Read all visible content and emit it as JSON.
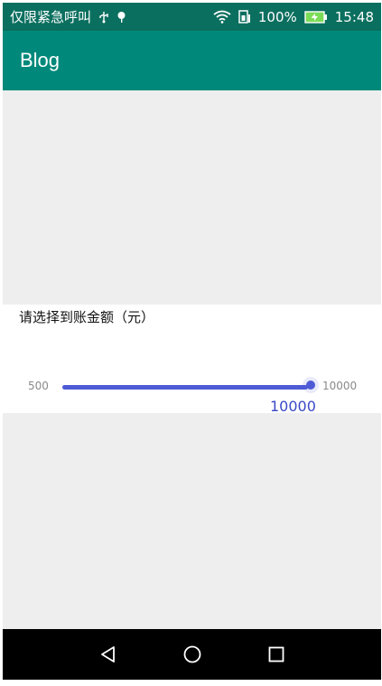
{
  "status_bar": {
    "carrier_text": "仅限紧急呼叫",
    "usb_icon": "usb-icon",
    "debug_icon": "android-debug-icon",
    "battery_percent": "100%",
    "time": "15:48"
  },
  "app_bar": {
    "title": "Blog"
  },
  "amount_card": {
    "title": "请选择到账金额（元）",
    "min_label": "500",
    "max_label": "10000",
    "current_value": "10000",
    "min": 500,
    "max": 10000,
    "value": 10000
  },
  "nav_bar": {
    "back_icon": "back-triangle-icon",
    "home_icon": "home-circle-icon",
    "recents_icon": "recents-square-icon"
  },
  "colors": {
    "status_bar": "#0b6f5f",
    "app_bar": "#00897b",
    "slider_accent": "#4f5bd5",
    "background": "#eeeeee"
  }
}
